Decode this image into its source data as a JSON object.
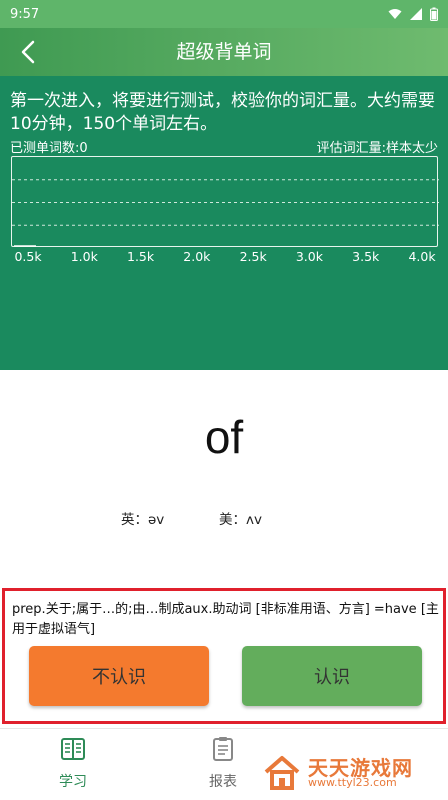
{
  "status": {
    "time": "9:57"
  },
  "app": {
    "title": "超级背单词"
  },
  "test": {
    "intro": "第一次进入，将要进行测试，校验你的词汇量。大约需要10分钟，150个单词左右。",
    "tested_count": "已测单词数:0",
    "estimate": "评估词汇量:样本太少"
  },
  "chart_data": {
    "type": "line",
    "x": [
      "0.5k",
      "1.0k",
      "1.5k",
      "2.0k",
      "2.5k",
      "3.0k",
      "3.5k",
      "4.0k"
    ],
    "series": [],
    "grid": true
  },
  "word": {
    "text": "of",
    "uk": "英：əv",
    "us": "美：ʌv"
  },
  "definition": "prep.关于;属于…的;由…制成aux.助动词 [非标准用语、方言] =have [主用于虚拟语气]",
  "buttons": {
    "unknown": "不认识",
    "known": "认识"
  },
  "nav": {
    "study": "学习",
    "report": "报表"
  },
  "watermark": {
    "title": "天天游戏网",
    "url": "www.ttyl23.com"
  },
  "colors": {
    "header": "#1a8a5e",
    "unknown_button": "#f47a2e",
    "known_button": "#63ad5c",
    "highlight_border": "#e0202c"
  }
}
